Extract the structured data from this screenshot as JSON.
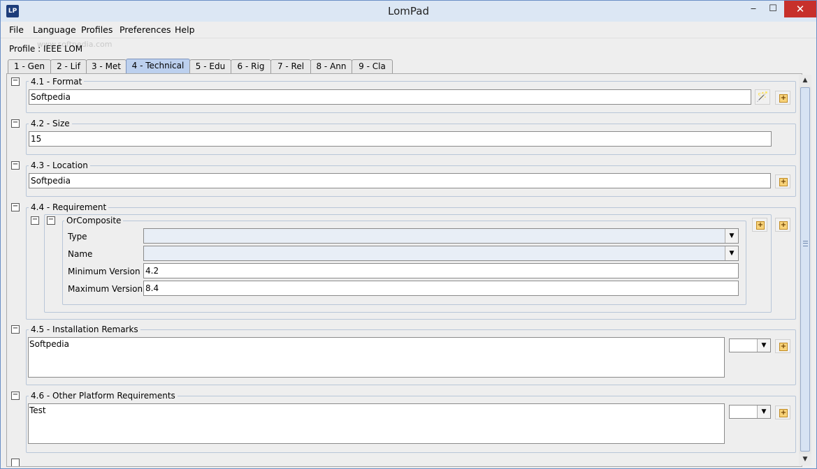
{
  "window": {
    "title": "LomPad",
    "min": "‒",
    "max": "☐",
    "close": "✕"
  },
  "menu": [
    "File",
    "Language",
    "Profiles",
    "Preferences",
    "Help"
  ],
  "profile": "Profile : IEEE LOM",
  "watermark": "www.softpedia.com",
  "tabs": [
    "1 - Gen",
    "2 - Lif",
    "3 - Met",
    "4 - Technical",
    "5 - Edu",
    "6 - Rig",
    "7 - Rel",
    "8 - Ann",
    "9 - Cla"
  ],
  "active_tab": "4 - Technical",
  "sections": {
    "format": {
      "label": "4.1 - Format",
      "value": "Softpedia"
    },
    "size": {
      "label": "4.2 - Size",
      "value": "15"
    },
    "location": {
      "label": "4.3 - Location",
      "value": "Softpedia"
    },
    "requirement": {
      "label": "4.4 - Requirement",
      "composite_label": "OrComposite",
      "type_label": "Type",
      "type_value": "",
      "name_label": "Name",
      "name_value": "",
      "min_label": "Minimum Version",
      "min_value": "4.2",
      "max_label": "Maximum Version",
      "max_value": "8.4"
    },
    "remarks": {
      "label": "4.5 - Installation Remarks",
      "value": "Softpedia"
    },
    "other": {
      "label": "4.6 - Other Platform Requirements",
      "value": "Test"
    }
  },
  "icons": {
    "collapse": "−",
    "add": "+",
    "wand": "🪄",
    "dropdown": "▼",
    "scroll_up": "▲",
    "scroll_down": "▼"
  }
}
